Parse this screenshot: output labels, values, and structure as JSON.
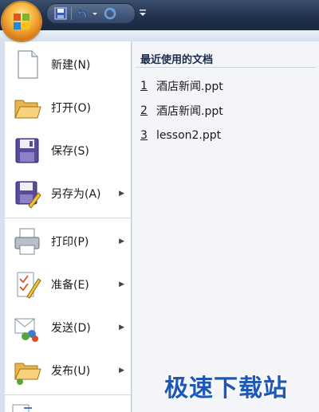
{
  "menu": {
    "items": [
      {
        "label": "新建(N)",
        "has_submenu": false
      },
      {
        "label": "打开(O)",
        "has_submenu": false
      },
      {
        "label": "保存(S)",
        "has_submenu": false
      },
      {
        "label": "另存为(A)",
        "has_submenu": true
      },
      {
        "label": "打印(P)",
        "has_submenu": true
      },
      {
        "label": "准备(E)",
        "has_submenu": true
      },
      {
        "label": "发送(D)",
        "has_submenu": true
      },
      {
        "label": "发布(U)",
        "has_submenu": true
      }
    ]
  },
  "recent": {
    "title": "最近使用的文档",
    "items": [
      {
        "num": "1",
        "name": "酒店新闻.ppt"
      },
      {
        "num": "2",
        "name": "酒店新闻.ppt"
      },
      {
        "num": "3",
        "name": "lesson2.ppt"
      }
    ]
  },
  "watermark": "极速下载站",
  "icons": {
    "office_button": "office-logo-icon",
    "save": "save-icon",
    "undo": "undo-icon",
    "redo": "redo-icon",
    "customize": "customize-qat-icon"
  },
  "colors": {
    "accent": "#1d57b8",
    "titlebar": "#22324b",
    "menu_bg": "#ffffff",
    "recent_bg": "#f4f5f9"
  }
}
